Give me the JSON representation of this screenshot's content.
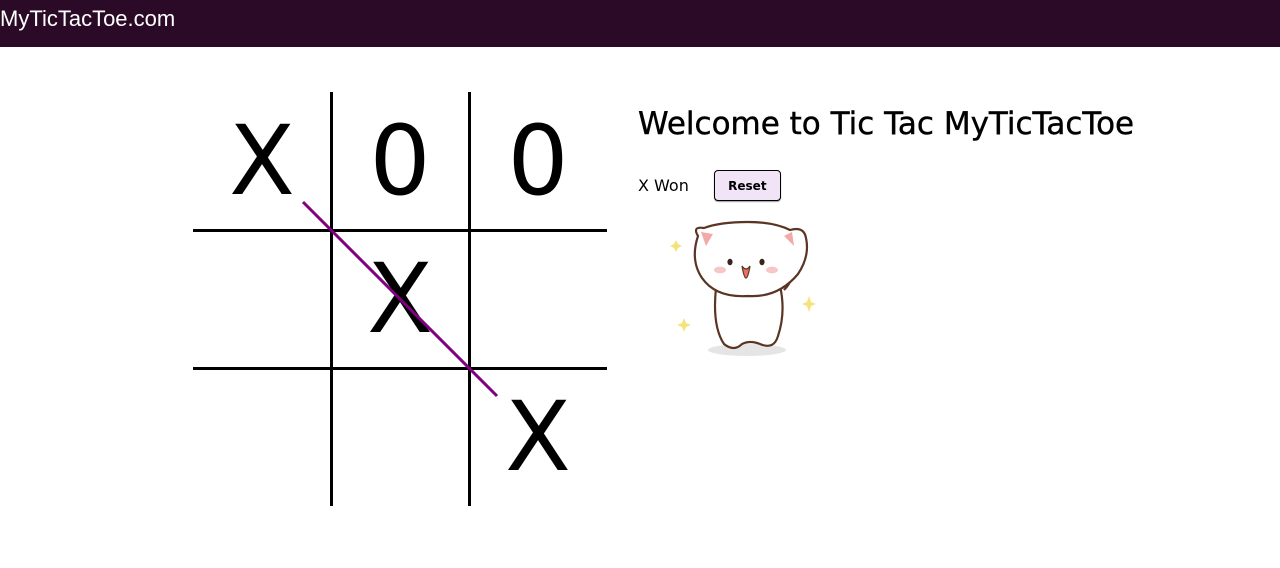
{
  "navbar": {
    "brand": "MyTicTacToe.com"
  },
  "board": {
    "cells": [
      "X",
      "0",
      "0",
      "",
      "X",
      "",
      "",
      "",
      "X"
    ],
    "winning_line": [
      0,
      4,
      8
    ],
    "line_color": "#800080",
    "grid_color": "#000000"
  },
  "info": {
    "title": "Welcome to Tic Tac MyTicTacToe",
    "status": "X Won",
    "reset_label": "Reset"
  },
  "illustration": {
    "icon": "dancing-cat-icon"
  },
  "colors": {
    "navbar_bg": "#2a0a26",
    "button_bg": "#f0e4f6"
  }
}
